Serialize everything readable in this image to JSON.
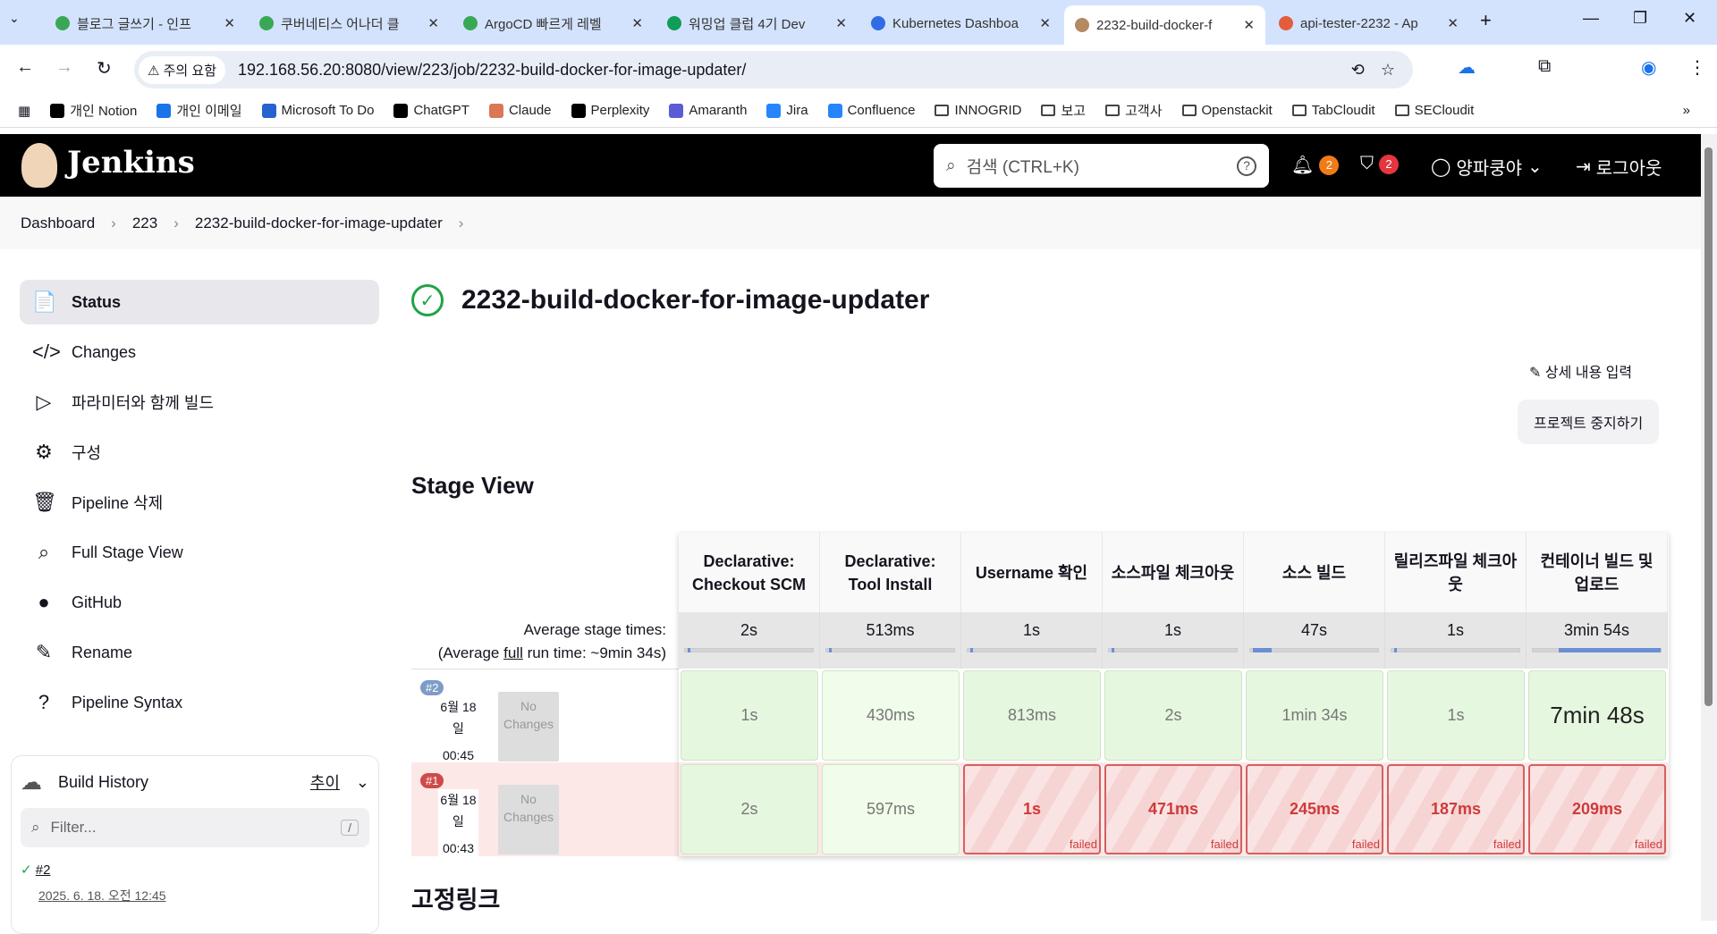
{
  "browser": {
    "tabs": [
      {
        "title": "블로그 글쓰기 - 인프",
        "color": "#3aa757"
      },
      {
        "title": "쿠버네티스 어나더 클",
        "color": "#3aa757"
      },
      {
        "title": "ArgoCD 빠르게 레벨",
        "color": "#3aa757"
      },
      {
        "title": "워밍업 클럽 4기 Dev",
        "color": "#0f9d58"
      },
      {
        "title": "Kubernetes Dashboa",
        "color": "#326ce5"
      },
      {
        "title": "2232-build-docker-f",
        "color": "#b48a63"
      },
      {
        "title": "api-tester-2232 - Ap",
        "color": "#e35d3d"
      }
    ],
    "warning": "주의 요함",
    "url": "192.168.56.20:8080/view/223/job/2232-build-docker-for-image-updater/",
    "bookmarks": [
      {
        "label": "개인 Notion",
        "color": "#000"
      },
      {
        "label": "개인 이메일",
        "color": "#1a73e8"
      },
      {
        "label": "Microsoft To Do",
        "color": "#2564cf"
      },
      {
        "label": "ChatGPT",
        "color": "#000"
      },
      {
        "label": "Claude",
        "color": "#d97757"
      },
      {
        "label": "Perplexity",
        "color": "#000"
      },
      {
        "label": "Amaranth",
        "color": "#5b5bd6"
      },
      {
        "label": "Jira",
        "color": "#2684ff"
      },
      {
        "label": "Confluence",
        "color": "#2684ff"
      },
      {
        "label": "INNOGRID",
        "color": "folder"
      },
      {
        "label": "보고",
        "color": "folder"
      },
      {
        "label": "고객사",
        "color": "folder"
      },
      {
        "label": "Openstackit",
        "color": "folder"
      },
      {
        "label": "TabCloudit",
        "color": "folder"
      },
      {
        "label": "SECloudit",
        "color": "folder"
      }
    ]
  },
  "header": {
    "logo": "Jenkins",
    "search_placeholder": "검색 (CTRL+K)",
    "notifications": "2",
    "security": "2",
    "user": "양파쿵야",
    "logout": "로그아웃"
  },
  "breadcrumb": [
    "Dashboard",
    "223",
    "2232-build-docker-for-image-updater"
  ],
  "sidebar": {
    "items": [
      {
        "icon": "📄",
        "label": "Status"
      },
      {
        "icon": "</>",
        "label": "Changes"
      },
      {
        "icon": "▷",
        "label": "파라미터와 함께 빌드"
      },
      {
        "icon": "⚙",
        "label": "구성"
      },
      {
        "icon": "🗑",
        "label": "Pipeline 삭제"
      },
      {
        "icon": "⌕",
        "label": "Full Stage View"
      },
      {
        "icon": "●",
        "label": "GitHub"
      },
      {
        "icon": "✎",
        "label": "Rename"
      },
      {
        "icon": "?",
        "label": "Pipeline Syntax"
      }
    ],
    "build_history": {
      "title": "Build History",
      "trend": "추이",
      "filter_placeholder": "Filter...",
      "shortcut": "/",
      "builds": [
        {
          "number": "#2",
          "date": "2025. 6. 18. 오전 12:45"
        }
      ]
    }
  },
  "main": {
    "title": "2232-build-docker-for-image-updater",
    "edit_description": "상세 내용 입력",
    "disable_project": "프로젝트 중지하기",
    "stage_view": "Stage View",
    "permalinks": "고정링크"
  },
  "stage_view": {
    "avg_label": "Average stage times:",
    "avg_run_prefix": "(Average ",
    "avg_run_link": "full",
    "avg_run_suffix": " run time: ~9min 34s)",
    "stages": [
      {
        "name": "Declarative: Checkout SCM",
        "avg": "2s",
        "avg_fraction": 0.02
      },
      {
        "name": "Declarative: Tool Install",
        "avg": "513ms",
        "avg_fraction": 0.01
      },
      {
        "name": "Username 확인",
        "avg": "1s",
        "avg_fraction": 0.01
      },
      {
        "name": "소스파일 체크아웃",
        "avg": "1s",
        "avg_fraction": 0.01
      },
      {
        "name": "소스 빌드",
        "avg": "47s",
        "avg_fraction": 0.15
      },
      {
        "name": "릴리즈파일 체크아웃",
        "avg": "1s",
        "avg_fraction": 0.01
      },
      {
        "name": "컨테이너 빌드 및 업로드",
        "avg": "3min 54s",
        "avg_fraction": 0.8
      }
    ],
    "builds": [
      {
        "number": "#2",
        "date": "6월 18일",
        "time": "00:45",
        "changes": "No Changes",
        "status": "success",
        "cells": [
          {
            "v": "1s",
            "s": "ok"
          },
          {
            "v": "430ms",
            "s": "ok"
          },
          {
            "v": "813ms",
            "s": "ok"
          },
          {
            "v": "2s",
            "s": "ok"
          },
          {
            "v": "1min 34s",
            "s": "ok"
          },
          {
            "v": "1s",
            "s": "ok"
          },
          {
            "v": "7min 48s",
            "s": "ok"
          }
        ]
      },
      {
        "number": "#1",
        "date": "6월 18일",
        "time": "00:43",
        "changes": "No Changes",
        "status": "failed",
        "cells": [
          {
            "v": "2s",
            "s": "ok"
          },
          {
            "v": "597ms",
            "s": "ok"
          },
          {
            "v": "1s",
            "s": "fail"
          },
          {
            "v": "471ms",
            "s": "fail"
          },
          {
            "v": "245ms",
            "s": "fail"
          },
          {
            "v": "187ms",
            "s": "fail"
          },
          {
            "v": "209ms",
            "s": "fail"
          }
        ]
      }
    ],
    "failed_label": "failed"
  }
}
